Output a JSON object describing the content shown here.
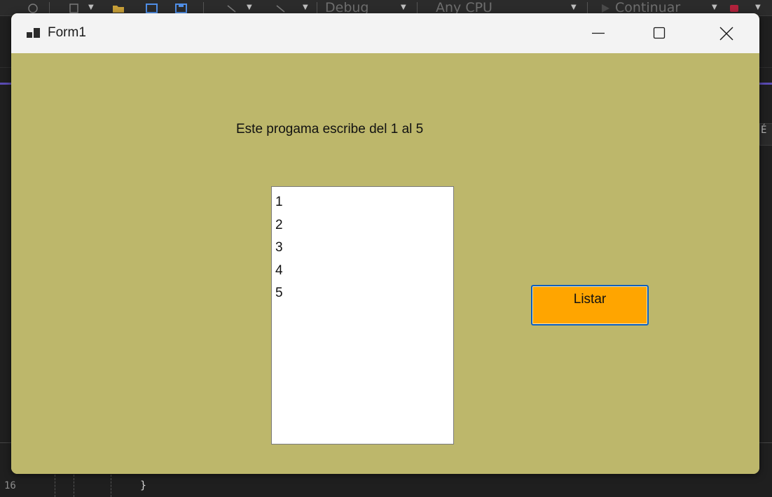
{
  "ide": {
    "toolbar": {
      "configuration": "Debug",
      "platform": "Any CPU",
      "run_label": "Continuar"
    },
    "editor": {
      "line_number": "16",
      "code_line": "}"
    },
    "side_glyph": "É"
  },
  "window": {
    "title": "Form1",
    "icon": "winforms-app-icon",
    "caption_buttons": {
      "minimize_icon": "minimize-icon",
      "maximize_icon": "maximize-icon",
      "close_icon": "close-icon"
    },
    "background_color": "#BDB76B"
  },
  "form": {
    "label_text": "Este progama escribe del 1 al 5",
    "listbox_items": [
      "1",
      "2",
      "3",
      "4",
      "5"
    ],
    "button": {
      "label": "Listar",
      "color": "#FFA500",
      "focus_border_color": "#0B5FBF"
    }
  }
}
